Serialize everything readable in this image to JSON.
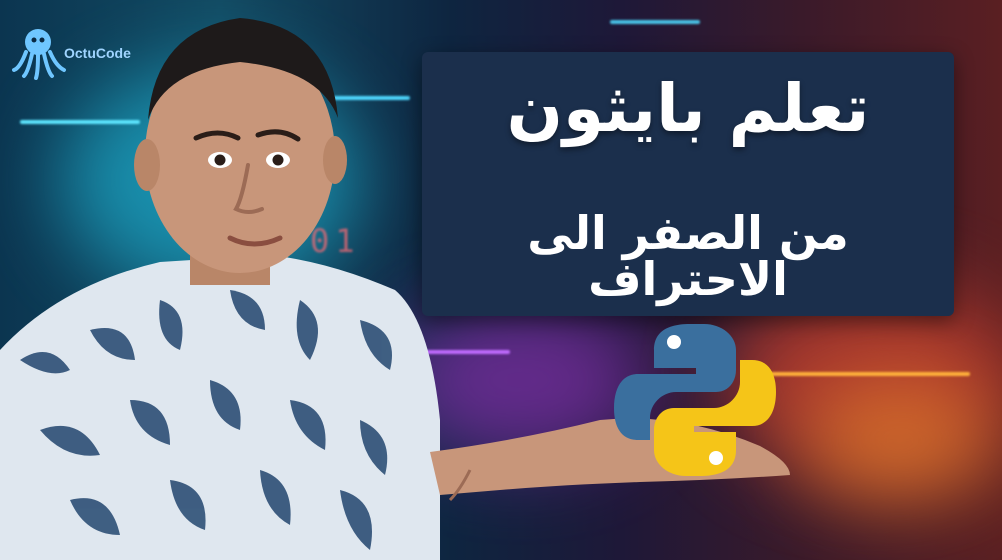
{
  "thumbnail": {
    "title": "تعلم بايثون",
    "subtitle": "من الصفر الى الاحتراف",
    "channel_logo_text": "OctuCode",
    "background_digits": "01"
  },
  "colors": {
    "panel": "#1b2f4c",
    "text": "#ffffff",
    "python_blue": "#3a6f9e",
    "python_yellow": "#f5c518",
    "shirt": "#dfe7ef"
  },
  "icons": [
    "octopus-logo-icon",
    "python-logo-icon"
  ]
}
